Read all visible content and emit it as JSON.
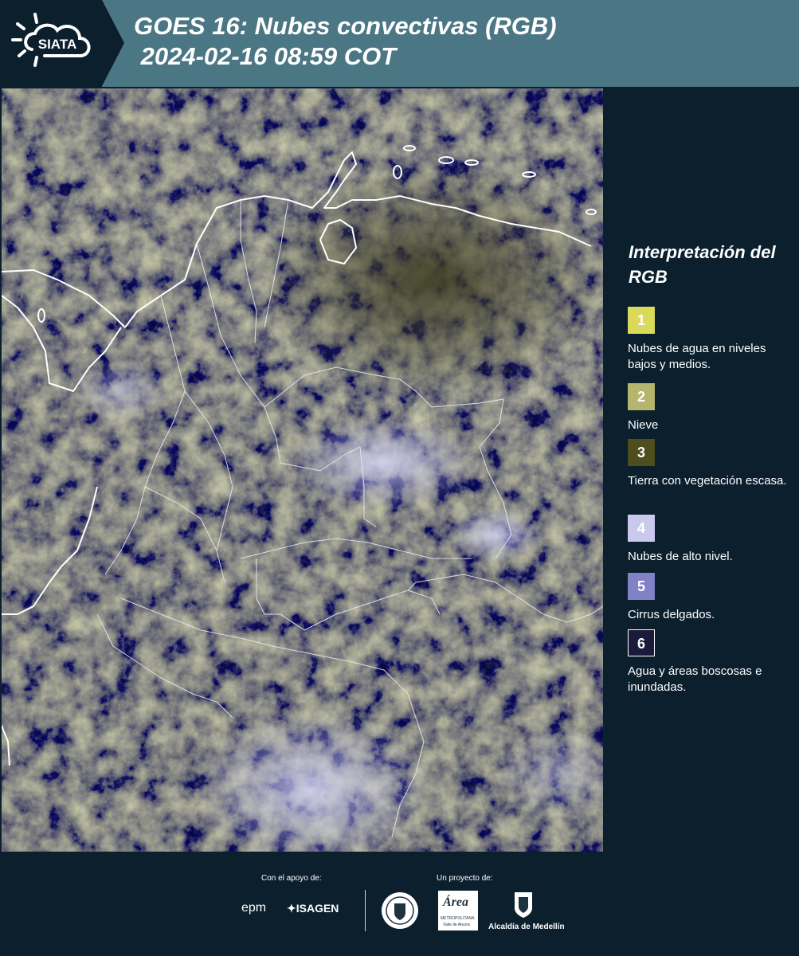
{
  "header": {
    "logo_text": "SIATA",
    "title": "GOES 16: Nubes convectivas (RGB)\n 2024-02-16 08:59 COT"
  },
  "legend": {
    "title": "Interpretación del RGB",
    "items": [
      {
        "num": "1",
        "color": "#d9d95a",
        "label": "Nubes de agua en niveles bajos y medios."
      },
      {
        "num": "2",
        "color": "#b5b56e",
        "label": "Nieve"
      },
      {
        "num": "3",
        "color": "#4d4d1e",
        "label": "Tierra con vegetación escasa."
      },
      {
        "num": "4",
        "color": "#c9c9ee",
        "label": "Nubes de alto nivel."
      },
      {
        "num": "5",
        "color": "#8181c6",
        "label": "Cirrus delgados."
      },
      {
        "num": "6",
        "color": "#1a1a3a",
        "label": "Agua y áreas boscosas e inundadas."
      }
    ]
  },
  "footer": {
    "support_caption": "Con el apoyo de:",
    "project_caption": "Un proyecto de:",
    "epm": "epm",
    "isagen": "ISAGEN",
    "area_main": "Área",
    "area_sub1": "METROPOLITANA",
    "area_sub2": "Valle de Aburrá",
    "alcaldia": "Alcaldía de Medellín"
  },
  "colors": {
    "background": "#0b1f2d",
    "header": "#4b7684",
    "boundary": "#ffffff",
    "cloud_yellow": "#c8c860",
    "cloud_lavender": "#c8c8f0"
  }
}
